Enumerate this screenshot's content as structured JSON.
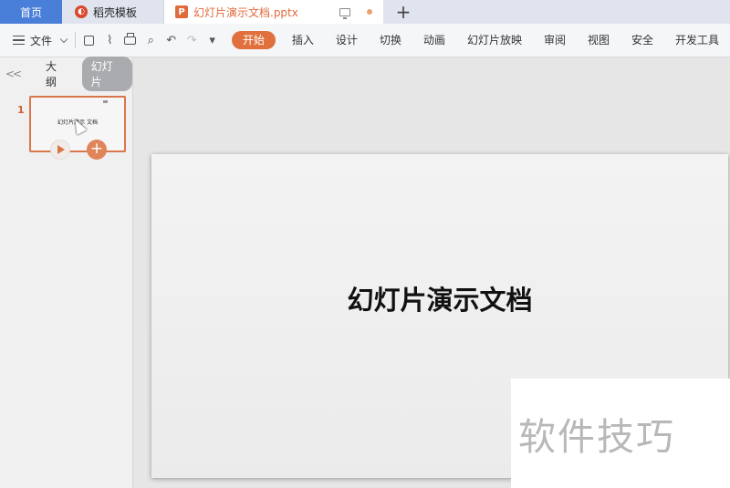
{
  "tabs": {
    "home": "首页",
    "template": "稻壳模板",
    "file": "幻灯片演示文档.pptx",
    "add": "+"
  },
  "toolbar": {
    "file_menu": "文件",
    "ribbon": [
      "开始",
      "插入",
      "设计",
      "切换",
      "动画",
      "幻灯片放映",
      "审阅",
      "视图",
      "安全",
      "开发工具"
    ]
  },
  "left_panel": {
    "collapse": "<<",
    "tab_outline": "大纲",
    "tab_slides": "幻灯片",
    "slide_number": "1",
    "thumb_title": "幻灯片演示 文档"
  },
  "slide": {
    "title": "幻灯片演示文档"
  },
  "watermark": {
    "text": "软件技巧"
  },
  "colors": {
    "accent": "#e0703d",
    "home_tab": "#4a7fd9"
  }
}
